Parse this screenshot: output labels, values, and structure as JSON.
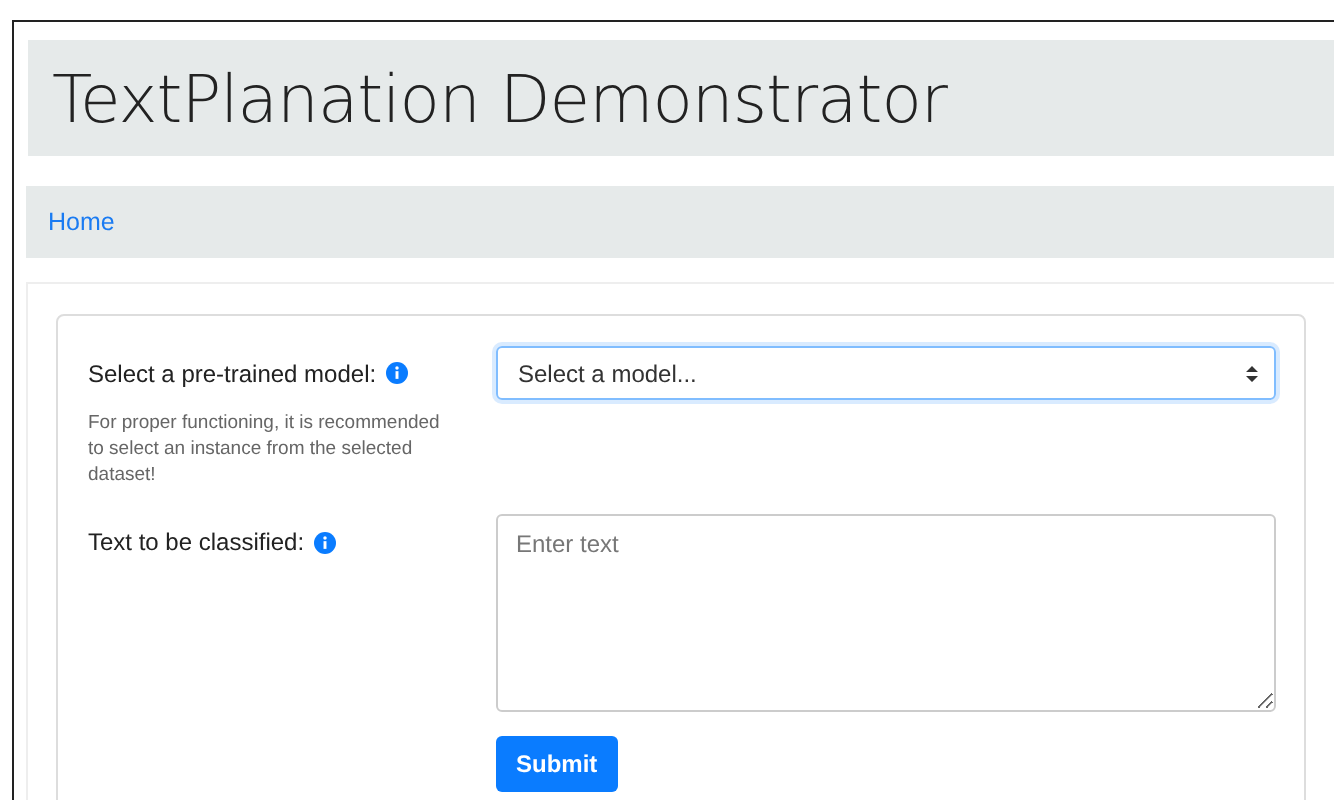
{
  "header": {
    "title": "TextPlanation Demonstrator"
  },
  "nav": {
    "items": [
      {
        "label": "Home"
      }
    ]
  },
  "form": {
    "model": {
      "label": "Select a pre-trained model:",
      "placeholder": "Select a model...",
      "help": "For proper functioning, it is recommended to select an instance from the selected dataset!"
    },
    "text": {
      "label": "Text to be classified:",
      "placeholder": "Enter text"
    },
    "submit": "Submit"
  }
}
